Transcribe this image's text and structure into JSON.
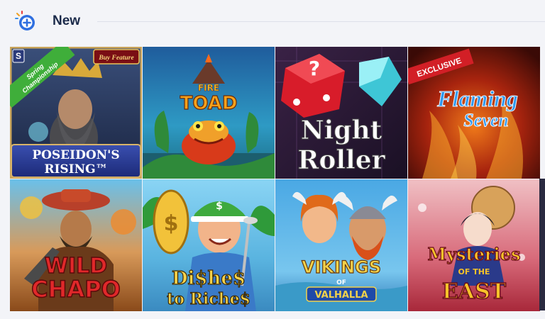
{
  "section": {
    "title": "New",
    "icon": "plus-badge-icon"
  },
  "games": [
    {
      "title_line1": "POSEIDON'S",
      "title_line2": "RISING™",
      "badge": "Buy Feature",
      "ribbon_line1": "Spring",
      "ribbon_line2": "Championship",
      "provider_badge": "S"
    },
    {
      "title_line1": "FIRE",
      "title_line2": "TOAD"
    },
    {
      "title_line1": "Night",
      "title_line2": "Roller"
    },
    {
      "title_line1": "Flaming",
      "title_line2": "Seven",
      "badge": "EXCLUSIVE"
    },
    {
      "title_line1": "WILD",
      "title_line2": "CHAPO"
    },
    {
      "title_line1": "Di$he$",
      "title_line2": "to Riche$"
    },
    {
      "title_line1": "VIKINGS",
      "title_line2": "OF",
      "title_line3": "VALHALLA"
    },
    {
      "title_line1": "Mysteries",
      "title_line2": "OF THE",
      "title_line3": "EAST"
    }
  ],
  "colors": {
    "background": "#f3f4f8",
    "title": "#1b2a4a",
    "accent_blue": "#2f6fe0",
    "ribbon_green": "#3fae3a",
    "exclusive_red": "#d21f26"
  }
}
